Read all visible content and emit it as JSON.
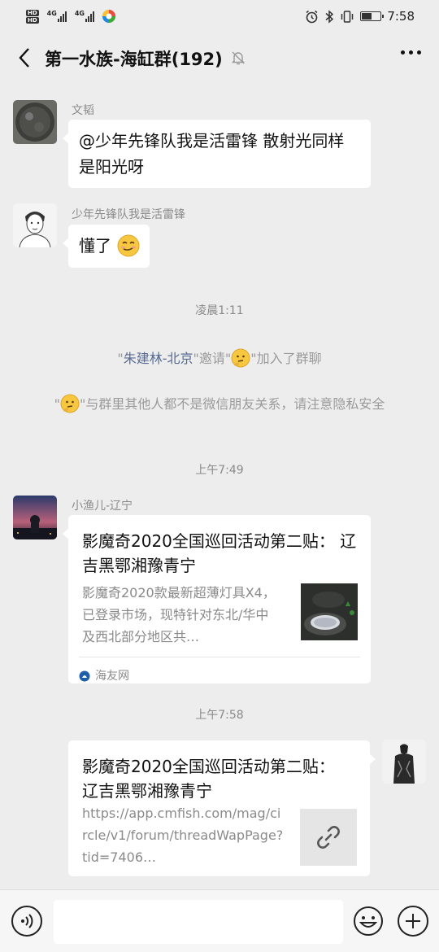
{
  "status_bar": {
    "hd_top": "HD",
    "hd_bottom": "HD",
    "net_1": "4G",
    "net_2": "4G",
    "time": "7:58",
    "battery_level": 0.55
  },
  "header": {
    "title": "第一水族-海缸群(192)",
    "back_icon": "chevron-left-icon",
    "mute_icon": "bell-off-icon",
    "more_icon": "more-icon"
  },
  "messages": [
    {
      "sender": "文韬",
      "text": "@少年先锋队我是活雷锋  散射光同样是阳光呀"
    },
    {
      "sender": "少年先锋队我是活雷锋",
      "text": "懂了"
    }
  ],
  "time_1": "凌晨1:11",
  "system_invite": {
    "q1": "\"",
    "inviter": "朱建林-北京",
    "mid": "\"邀请\"",
    "tail": "\"加入了群聊"
  },
  "system_warning": {
    "q1": "\"",
    "tail": "\"与群里其他人都不是微信朋友关系，请注意隐私安全"
  },
  "time_2": "上午7:49",
  "card_message": {
    "sender": "小渔儿-辽宁",
    "title": "影魔奇2020全国巡回活动第二贴：  辽吉黑鄂湘豫青宁",
    "desc": "影魔奇2020款最新超薄灯具X4，已登录市场，现特针对东北/华中及西北部分地区共…",
    "source": "海友网"
  },
  "time_3": "上午7:58",
  "my_card": {
    "title": "影魔奇2020全国巡回活动第二贴：  辽吉黑鄂湘豫青宁",
    "url": "https://app.cmfish.com/mag/circle/v1/forum/threadWapPage?tid=7406…"
  },
  "input_bar": {
    "placeholder": "",
    "voice_icon": "voice-icon",
    "emoji_icon": "emoji-icon",
    "plus_icon": "plus-icon"
  }
}
